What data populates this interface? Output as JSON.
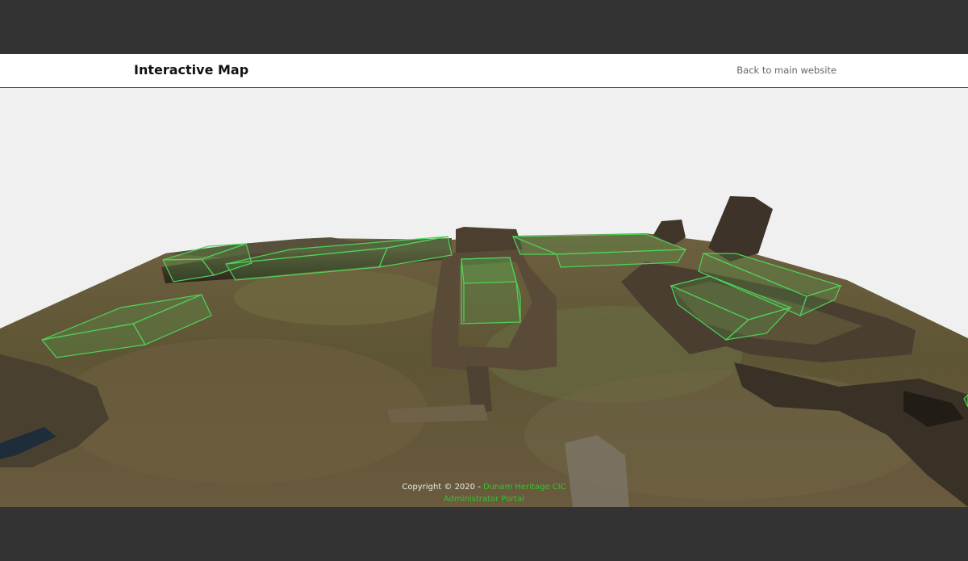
{
  "header": {
    "title": "Interactive Map",
    "back_link": "Back to main website"
  },
  "footer": {
    "copyright_prefix": "Copyright © 2020 -",
    "org_link": "Dunam Heritage CIC",
    "admin_link": "Administrator Portal"
  },
  "colors": {
    "accent": "#35c235",
    "zone_outline": "#4fd35a",
    "viewport_bg": "#f0f0f0",
    "chrome_bg": "#333333"
  },
  "map": {
    "selectable_zones": 8
  }
}
